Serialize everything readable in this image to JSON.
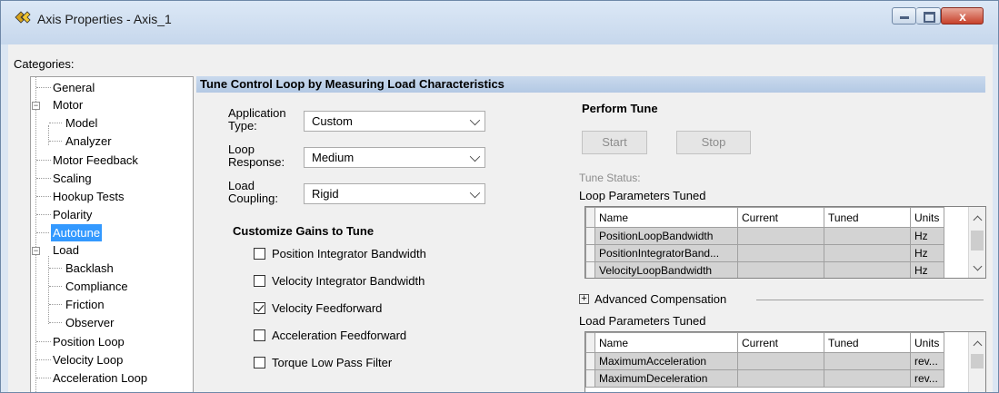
{
  "window": {
    "title": "Axis Properties - Axis_1",
    "close_glyph": "x"
  },
  "categories": {
    "label": "Categories:",
    "items": [
      {
        "label": "General"
      },
      {
        "label": "Motor",
        "expander": "−"
      },
      {
        "label": "Model"
      },
      {
        "label": "Analyzer"
      },
      {
        "label": "Motor Feedback"
      },
      {
        "label": "Scaling"
      },
      {
        "label": "Hookup Tests"
      },
      {
        "label": "Polarity"
      },
      {
        "label": "Autotune",
        "selected": true
      },
      {
        "label": "Load",
        "expander": "−"
      },
      {
        "label": "Backlash"
      },
      {
        "label": "Compliance"
      },
      {
        "label": "Friction"
      },
      {
        "label": "Observer"
      },
      {
        "label": "Position Loop"
      },
      {
        "label": "Velocity Loop"
      },
      {
        "label": "Acceleration Loop"
      }
    ]
  },
  "header": {
    "title": "Tune Control Loop by Measuring Load Characteristics"
  },
  "form": {
    "application_type": {
      "label1": "Application",
      "label2": "Type:",
      "value": "Custom"
    },
    "loop_response": {
      "label1": "Loop",
      "label2": "Response:",
      "value": "Medium"
    },
    "load_coupling": {
      "label1": "Load",
      "label2": "Coupling:",
      "value": "Rigid"
    }
  },
  "gains": {
    "title": "Customize Gains to Tune",
    "items": [
      {
        "label": "Position Integrator Bandwidth",
        "checked": false
      },
      {
        "label": "Velocity Integrator Bandwidth",
        "checked": false
      },
      {
        "label": "Velocity Feedforward",
        "checked": true
      },
      {
        "label": "Acceleration Feedforward",
        "checked": false
      },
      {
        "label": "Torque Low Pass Filter",
        "checked": false
      }
    ]
  },
  "perform": {
    "title": "Perform Tune",
    "start_label": "Start",
    "stop_label": "Stop",
    "status_label": "Tune Status:"
  },
  "loop_params": {
    "label": "Loop Parameters Tuned",
    "columns": [
      "Name",
      "Current",
      "Tuned",
      "Units"
    ],
    "rows": [
      [
        "PositionLoopBandwidth",
        "",
        "",
        "Hz"
      ],
      [
        "PositionIntegratorBand...",
        "",
        "",
        "Hz"
      ],
      [
        "VelocityLoopBandwidth",
        "",
        "",
        "Hz"
      ]
    ]
  },
  "advanced": {
    "expander": "+",
    "label": "Advanced Compensation"
  },
  "load_params": {
    "label": "Load Parameters Tuned",
    "columns": [
      "Name",
      "Current",
      "Tuned",
      "Units"
    ],
    "rows": [
      [
        "MaximumAcceleration",
        "",
        "",
        "rev..."
      ],
      [
        "MaximumDeceleration",
        "",
        "",
        "rev..."
      ]
    ]
  }
}
